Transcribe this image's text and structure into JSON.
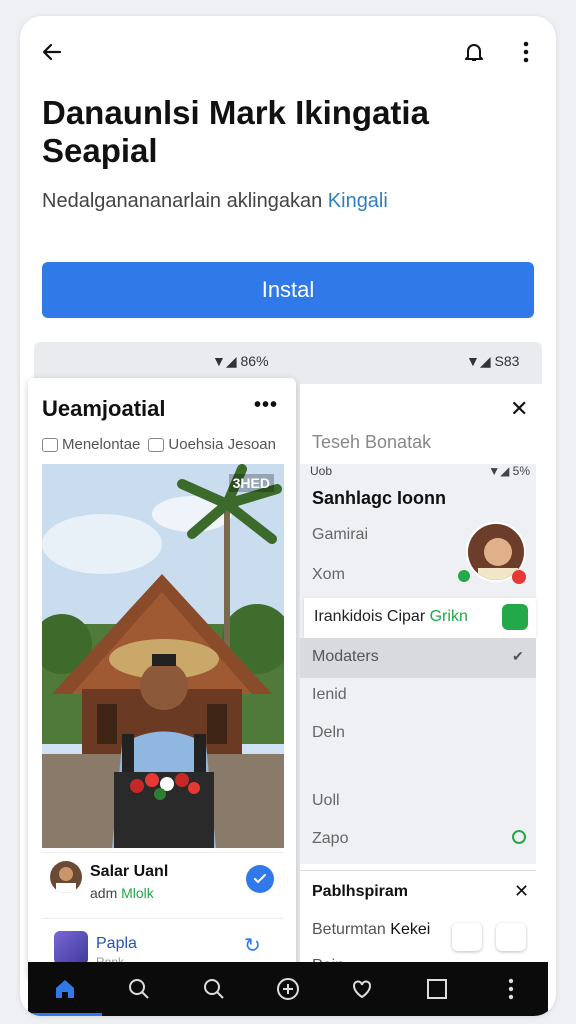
{
  "header": {
    "back_icon": "arrow-left-icon",
    "notify_icon": "bell-icon",
    "more_icon": "kebab-menu-icon"
  },
  "app": {
    "title": "Danaunlsi Mark Ikingatia Seapial",
    "subtitle": "Nedalganananarlain aklingakan",
    "subtitle_link": "Kingali",
    "install_label": "Instal",
    "accent": "#2f7ae8"
  },
  "preview": {
    "status_left": "▼◢ 86%",
    "status_right": "▼◢ S83",
    "left_screen": {
      "title": "Ueamjoatial",
      "more": "•••",
      "tabs": [
        "Menelontae",
        "Uoehsia Jesoan"
      ],
      "photo_tag": "3HED",
      "user_name": "Salar Uanl",
      "user_sub_prefix": "adm",
      "user_sub_green": "Mlolk",
      "row2_label": "Papla",
      "row2_sub": "Rnnk"
    },
    "right_screen": {
      "search_placeholder": "Teseh Bonatak",
      "status": "▼◢ 5%",
      "status_left": "Uob",
      "heading": "Sanhlagc Ioonn",
      "items": [
        "Gamirai",
        "Xom"
      ],
      "highlight_label": "Irankidois Cipar",
      "highlight_green": "Grikn",
      "selected": "Modaters",
      "more_items": [
        "Ienid",
        "Deln",
        "Uoll",
        "Zapo"
      ],
      "bottom_title": "Pablhspiram",
      "bottom_line1_prefix": "Beturmtan",
      "bottom_line1_dark": "Kekei",
      "bottom_line2": "Pein"
    }
  },
  "nav": {
    "items": [
      "home-icon",
      "search-icon",
      "search-icon",
      "add-circle-icon",
      "heart-icon",
      "square-icon",
      "kebab-menu-icon"
    ],
    "active_index": 0
  }
}
